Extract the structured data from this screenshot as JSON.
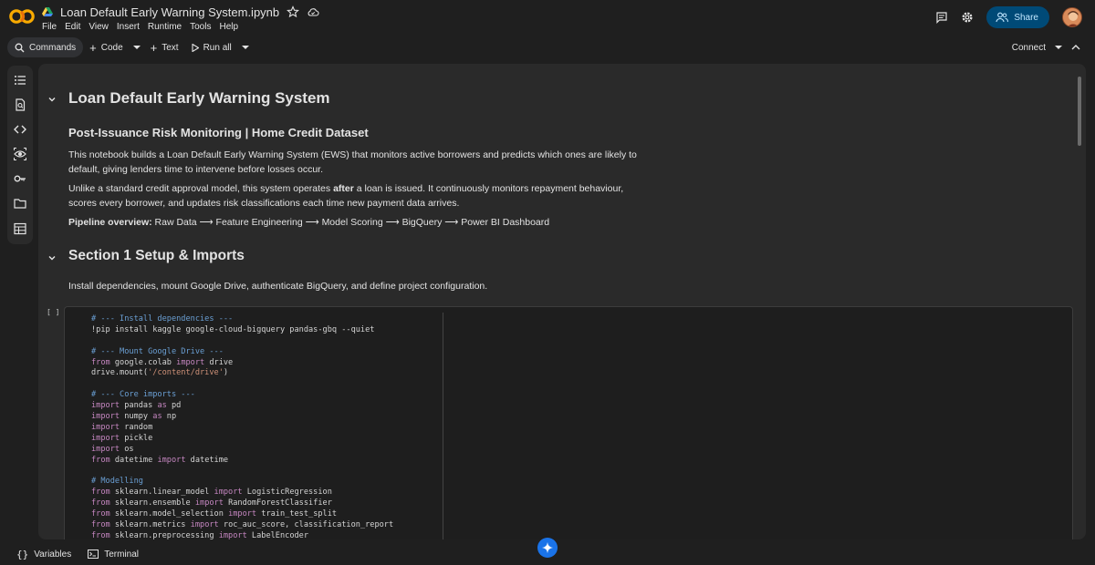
{
  "header": {
    "notebook_title": "Loan Default Early Warning System.ipynb",
    "menu": [
      "File",
      "Edit",
      "View",
      "Insert",
      "Runtime",
      "Tools",
      "Help"
    ],
    "share_label": "Share"
  },
  "toolbar": {
    "commands_label": "Commands",
    "code_label": "Code",
    "text_label": "Text",
    "run_all_label": "Run all",
    "connect_label": "Connect"
  },
  "sidebar": {
    "icons": [
      "table-of-contents-icon",
      "find-replace-icon",
      "code-snippets-icon",
      "variables-inspector-icon",
      "secrets-key-icon",
      "files-folder-icon",
      "data-table-icon"
    ]
  },
  "notebook": {
    "title": "Loan Default Early Warning System",
    "subtitle": "Post-Issuance Risk Monitoring | Home Credit Dataset",
    "para1": "This notebook builds a Loan Default Early Warning System (EWS) that monitors active borrowers and predicts which ones are likely to default, giving lenders time to intervene before losses occur.",
    "para2_pre": "Unlike a standard credit approval model, this system operates ",
    "para2_bold": "after",
    "para2_post": " a loan is issued. It continuously monitors repayment behaviour, scores every borrower, and updates risk classifications each time new payment data arrives.",
    "pipeline_label": "Pipeline overview:",
    "pipeline_text": " Raw Data ⟶ Feature Engineering ⟶ Model Scoring ⟶ BigQuery ⟶ Power BI Dashboard",
    "section1_title": "Section 1 Setup & Imports",
    "section1_desc": "Install dependencies, mount Google Drive, authenticate BigQuery, and define project configuration.",
    "cell_bracket": "[ ]"
  },
  "code_lines": [
    [
      [
        "c-cm",
        "# --- Install dependencies ---"
      ]
    ],
    [
      [
        "c-pl",
        "!pip install kaggle google-cloud-bigquery pandas-gbq --quiet"
      ]
    ],
    [],
    [
      [
        "c-cm",
        "# --- Mount Google Drive ---"
      ]
    ],
    [
      [
        "c-kw",
        "from"
      ],
      [
        "c-pl",
        " google.colab "
      ],
      [
        "c-kw",
        "import"
      ],
      [
        "c-pl",
        " drive"
      ]
    ],
    [
      [
        "c-pl",
        "drive.mount("
      ],
      [
        "c-st",
        "'/content/drive'"
      ],
      [
        "c-pl",
        ")"
      ]
    ],
    [],
    [
      [
        "c-cm",
        "# --- Core imports ---"
      ]
    ],
    [
      [
        "c-kw",
        "import"
      ],
      [
        "c-pl",
        " pandas "
      ],
      [
        "c-kw",
        "as"
      ],
      [
        "c-pl",
        " pd"
      ]
    ],
    [
      [
        "c-kw",
        "import"
      ],
      [
        "c-pl",
        " numpy "
      ],
      [
        "c-kw",
        "as"
      ],
      [
        "c-pl",
        " np"
      ]
    ],
    [
      [
        "c-kw",
        "import"
      ],
      [
        "c-pl",
        " random"
      ]
    ],
    [
      [
        "c-kw",
        "import"
      ],
      [
        "c-pl",
        " pickle"
      ]
    ],
    [
      [
        "c-kw",
        "import"
      ],
      [
        "c-pl",
        " os"
      ]
    ],
    [
      [
        "c-kw",
        "from"
      ],
      [
        "c-pl",
        " datetime "
      ],
      [
        "c-kw",
        "import"
      ],
      [
        "c-pl",
        " datetime"
      ]
    ],
    [],
    [
      [
        "c-cm",
        "# Modelling"
      ]
    ],
    [
      [
        "c-kw",
        "from"
      ],
      [
        "c-pl",
        " sklearn.linear_model "
      ],
      [
        "c-kw",
        "import"
      ],
      [
        "c-pl",
        " LogisticRegression"
      ]
    ],
    [
      [
        "c-kw",
        "from"
      ],
      [
        "c-pl",
        " sklearn.ensemble "
      ],
      [
        "c-kw",
        "import"
      ],
      [
        "c-pl",
        " RandomForestClassifier"
      ]
    ],
    [
      [
        "c-kw",
        "from"
      ],
      [
        "c-pl",
        " sklearn.model_selection "
      ],
      [
        "c-kw",
        "import"
      ],
      [
        "c-pl",
        " train_test_split"
      ]
    ],
    [
      [
        "c-kw",
        "from"
      ],
      [
        "c-pl",
        " sklearn.metrics "
      ],
      [
        "c-kw",
        "import"
      ],
      [
        "c-pl",
        " roc_auc_score, classification_report"
      ]
    ],
    [
      [
        "c-kw",
        "from"
      ],
      [
        "c-pl",
        " sklearn.preprocessing "
      ],
      [
        "c-kw",
        "import"
      ],
      [
        "c-pl",
        " LabelEncoder"
      ]
    ]
  ],
  "footer": {
    "variables_label": "Variables",
    "terminal_label": "Terminal"
  }
}
